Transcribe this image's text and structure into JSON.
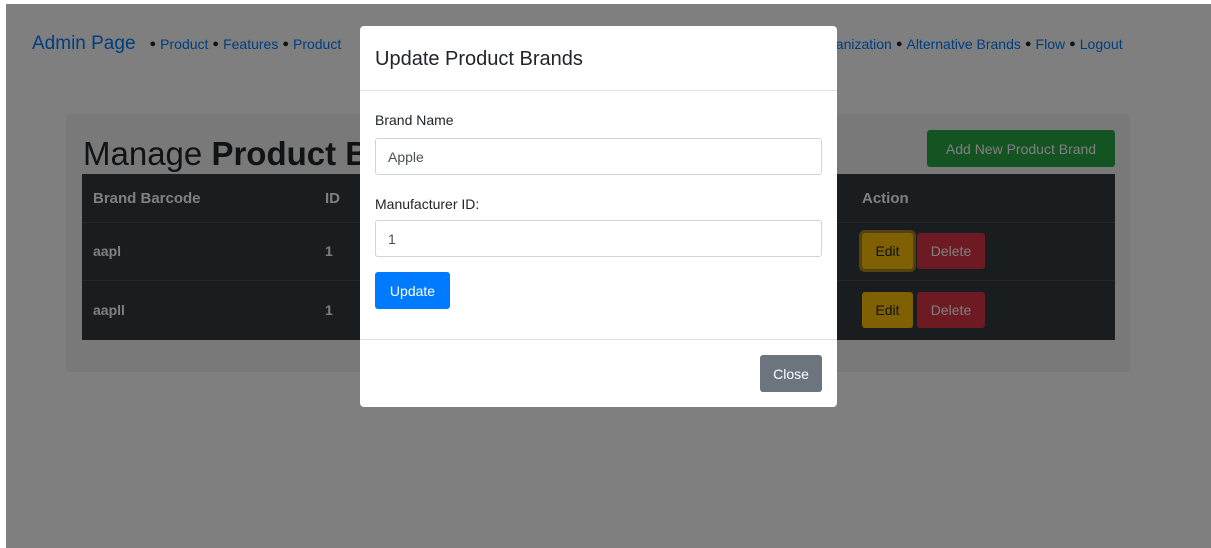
{
  "nav": {
    "brand": "Admin Page",
    "links_left": [
      "Product",
      "Features",
      "Product"
    ],
    "links_right": [
      "ganization",
      "Alternative Brands",
      "Flow",
      "Logout"
    ]
  },
  "card": {
    "title_prefix": "Manage",
    "title_bold": "Product Bra",
    "add_button": "Add New Product Brand"
  },
  "table": {
    "headers": {
      "barcode": "Brand Barcode",
      "id": "ID",
      "action": "Action"
    },
    "rows": [
      {
        "barcode": "aapl",
        "id": "1"
      },
      {
        "barcode": "aapll",
        "id": "1"
      }
    ],
    "edit_label": "Edit",
    "delete_label": "Delete"
  },
  "modal": {
    "title": "Update Product Brands",
    "brand_name_label": "Brand Name",
    "brand_name_value": "Apple",
    "manufacturer_label": "Manufacturer ID:",
    "manufacturer_value": "1",
    "update_button": "Update",
    "close_button": "Close"
  },
  "colors": {
    "primary": "#007bff",
    "success": "#28a745",
    "warning": "#ffc107",
    "danger": "#dc3545",
    "secondary": "#6c757d",
    "table_dark": "#343a40"
  }
}
